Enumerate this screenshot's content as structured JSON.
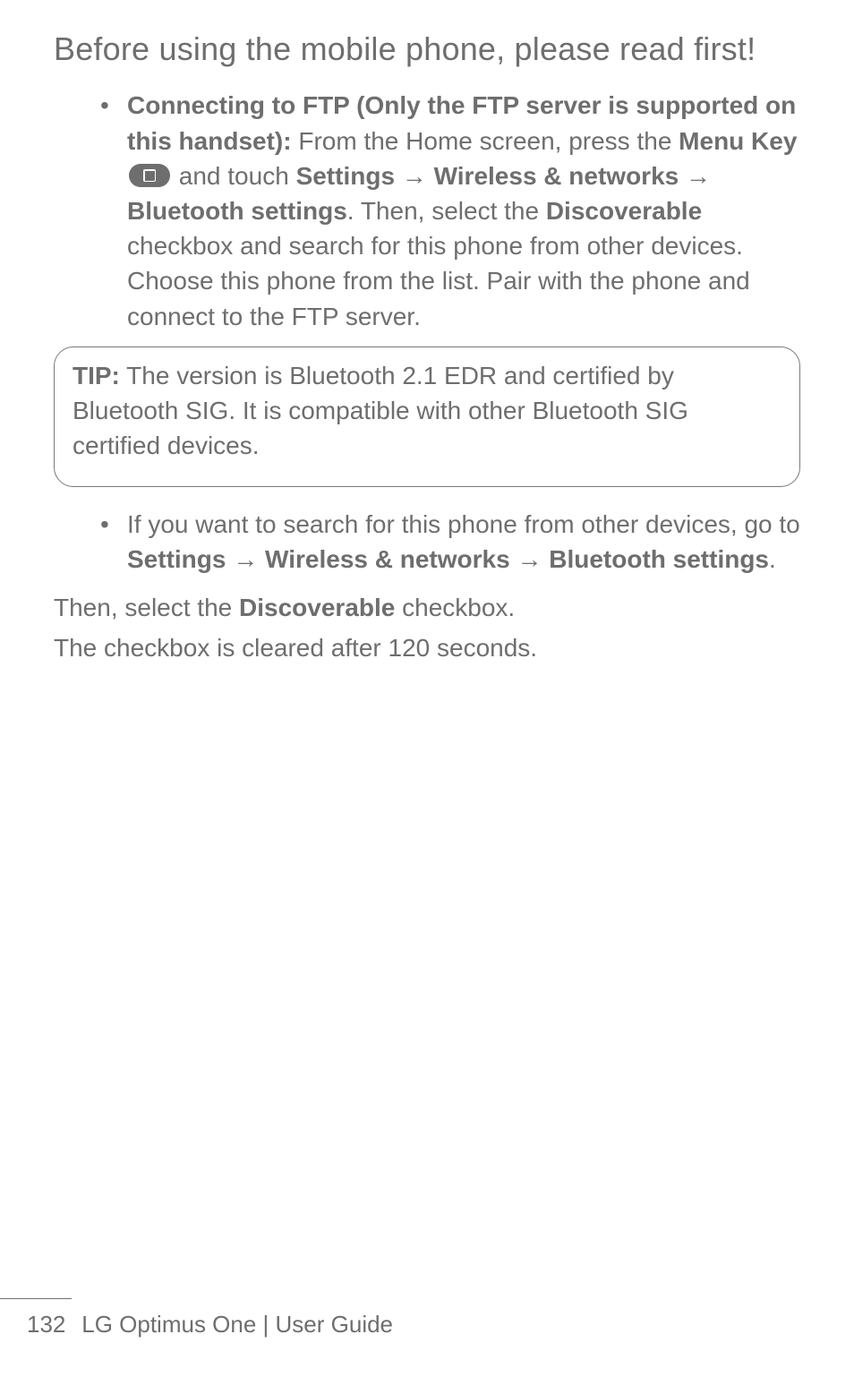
{
  "title": "Before using the mobile phone, please read first!",
  "bullet1": {
    "lead_bold": "Connecting to FTP (Only the FTP server is supported on this handset):",
    "seg1": " From the Home screen, press the ",
    "menu_key_bold": "Menu Key",
    "seg2": " and touch ",
    "settings_bold": "Settings",
    "arrow1": " → ",
    "wireless_bold": "Wireless & networks",
    "arrow2": " → ",
    "bt_settings_bold": "Bluetooth settings",
    "seg3": ". Then, select the ",
    "discoverable_bold": "Discoverable",
    "seg4": " checkbox and search for this phone from other devices. Choose this phone from the list. Pair with the phone and connect to the FTP server."
  },
  "tip": {
    "label": "TIP:",
    "body": " The version is Bluetooth 2.1 EDR and certified by Bluetooth SIG. It is compatible with other Bluetooth SIG certified devices."
  },
  "bullet2": {
    "seg1": "If you want to search for this phone from other devices, go to ",
    "settings_bold": "Settings",
    "arrow1": " → ",
    "wireless_bold": "Wireless & networks",
    "arrow2": " → ",
    "bt_settings_bold": "Bluetooth settings",
    "period": "."
  },
  "after1": {
    "seg1": "Then, select the ",
    "discoverable_bold": "Discoverable",
    "seg2": " checkbox."
  },
  "after2": "The checkbox is cleared after 120 seconds.",
  "footer": {
    "page": "132",
    "product": "LG Optimus One",
    "sep": "  |  ",
    "guide": "User Guide"
  }
}
